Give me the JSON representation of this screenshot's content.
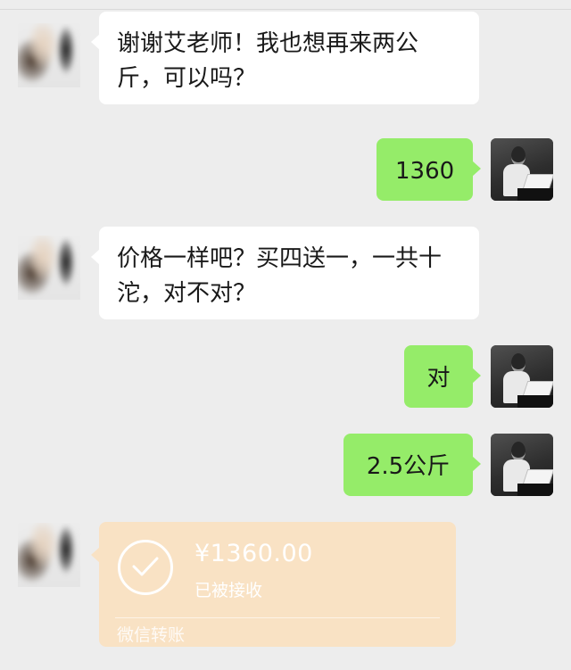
{
  "messages": [
    {
      "side": "left",
      "text": "谢谢艾老师！我也想再来两公斤，可以吗？"
    },
    {
      "side": "right",
      "text": "1360"
    },
    {
      "side": "left",
      "text": "价格一样吧？买四送一，一共十沱，对不对？"
    },
    {
      "side": "right",
      "text": "对"
    },
    {
      "side": "right",
      "text": "2.5公斤"
    }
  ],
  "transfer": {
    "amount": "¥1360.00",
    "status": "已被接收",
    "footer": "微信转账",
    "icon": "check-circle-icon"
  },
  "colors": {
    "background": "#ededed",
    "bubble_self": "#95ec69",
    "bubble_other": "#ffffff",
    "transfer_card": "#f9e2c4"
  },
  "icons": {
    "contact_avatar": "blurred-avatar",
    "self_avatar": "photo-avatar"
  }
}
